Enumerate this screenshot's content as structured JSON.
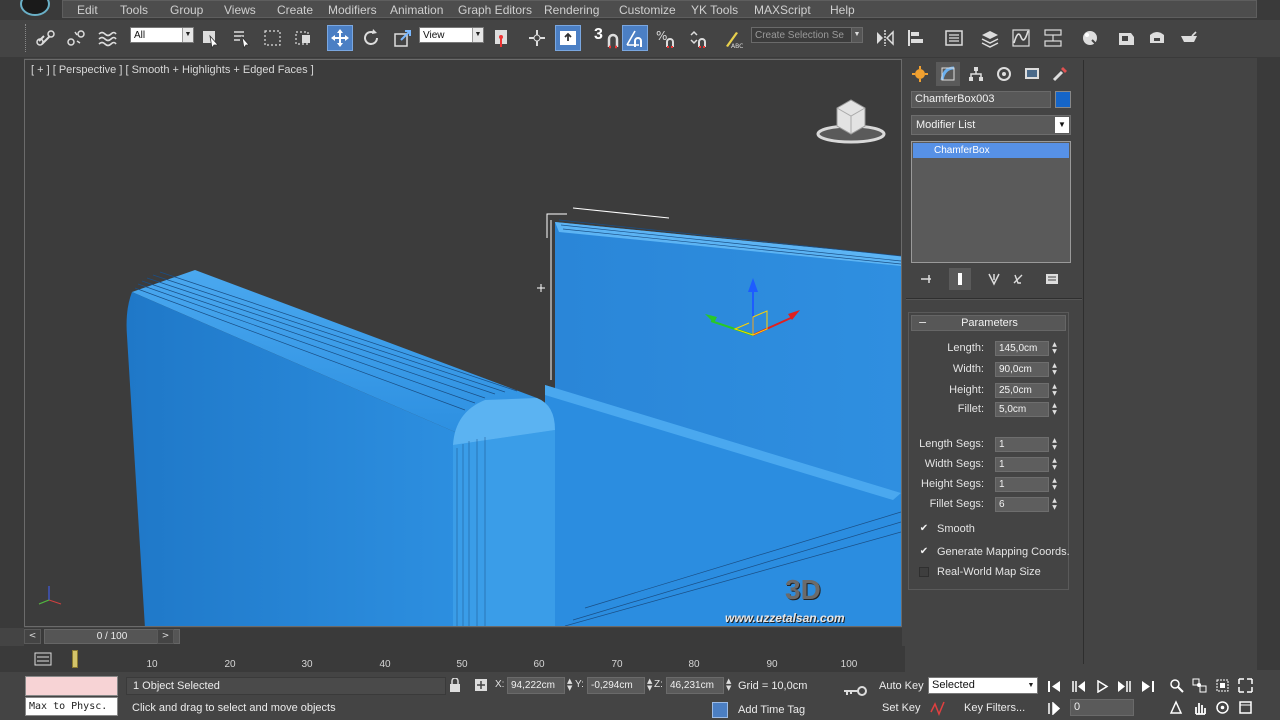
{
  "menu": [
    "Edit",
    "Tools",
    "Group",
    "Views",
    "Create",
    "Modifiers",
    "Animation",
    "Graph Editors",
    "Rendering",
    "Customize",
    "YK Tools",
    "MAXScript",
    "Help"
  ],
  "toolbar": {
    "selection_filter": "All",
    "ref_coord": "View",
    "snap_number": "3",
    "named_selection_placeholder": "Create Selection Se",
    "icons": [
      "link-icon",
      "unlink-icon",
      "bind-spacewarp-icon",
      "select-object-icon",
      "select-by-name-icon",
      "rect-selection-icon",
      "window-crossing-icon",
      "move-icon",
      "rotate-icon",
      "scale-icon",
      "mirror-icon",
      "align-icon",
      "layer-manager-icon",
      "curve-editor-icon",
      "schematic-view-icon",
      "material-editor-icon",
      "render-setup-icon",
      "render-frame-icon",
      "render-icon"
    ]
  },
  "viewport": {
    "label": "[ + ] [ Perspective ] [ Smooth + Highlights + Edged Faces ]",
    "watermark_logo": "3D",
    "watermark_url": "www.uzzetalsan.com",
    "object_color": "#2f8fe0"
  },
  "command_panel": {
    "tabs": [
      "create-icon",
      "modify-icon",
      "hierarchy-icon",
      "motion-icon",
      "display-icon",
      "utilities-icon"
    ],
    "object_name": "ChamferBox003",
    "object_color": "#1565c8",
    "modifier_list": "Modifier List",
    "stack_items": [
      "ChamferBox"
    ],
    "rollout_title": "Parameters",
    "params": [
      {
        "label": "Length:",
        "value": "145,0cm"
      },
      {
        "label": "Width:",
        "value": "90,0cm"
      },
      {
        "label": "Height:",
        "value": "25,0cm"
      },
      {
        "label": "Fillet:",
        "value": "5,0cm"
      }
    ],
    "segs": [
      {
        "label": "Length Segs:",
        "value": "1"
      },
      {
        "label": "Width Segs:",
        "value": "1"
      },
      {
        "label": "Height Segs:",
        "value": "1"
      },
      {
        "label": "Fillet Segs:",
        "value": "6"
      }
    ],
    "checks": [
      {
        "label": "Smooth",
        "checked": true
      },
      {
        "label": "Generate Mapping Coords.",
        "checked": true
      },
      {
        "label": "Real-World Map Size",
        "checked": false
      }
    ]
  },
  "timeline": {
    "position": "0 / 100",
    "ticks": [
      "10",
      "20",
      "30",
      "40",
      "50",
      "60",
      "70",
      "80",
      "90",
      "100"
    ]
  },
  "status": {
    "maxscript": "Max to Physc.",
    "selection": "1 Object Selected",
    "prompt": "Click and drag to select and move objects",
    "x_label": "X:",
    "x": "94,222cm",
    "y_label": "Y:",
    "y": "-0,294cm",
    "z_label": "Z:",
    "z": "46,231cm",
    "grid": "Grid = 10,0cm",
    "add_time_tag": "Add Time Tag",
    "auto_key": "Auto Key",
    "set_key": "Set Key",
    "key_mode": "Selected",
    "key_filters": "Key Filters...",
    "frame": "0"
  }
}
